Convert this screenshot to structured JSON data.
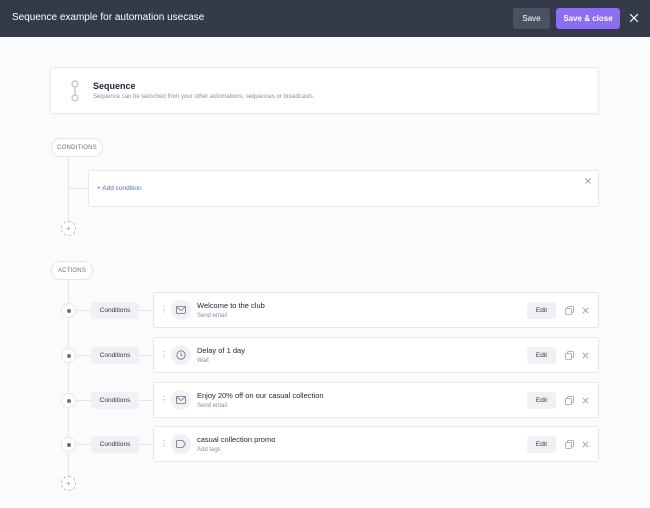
{
  "header": {
    "title": "Sequence example for automation usecase",
    "save_label": "Save",
    "save_close_label": "Save & close",
    "background": "#343a47",
    "accent": "#8b6ff0"
  },
  "sequence": {
    "title": "Sequence",
    "subtitle": "Sequence can be launched from your other automations, sequences or broadcasts.",
    "icon": "sequence-icon"
  },
  "conditions": {
    "label": "CONDITIONS",
    "add_label": "+ Add condition",
    "add_button": "+"
  },
  "actions": {
    "label": "ACTIONS",
    "add_button": "+",
    "items": [
      {
        "conditions_label": "Conditions",
        "title": "Welcome to the club",
        "subtitle": "Send email",
        "icon": "email-icon",
        "edit_label": "Edit"
      },
      {
        "conditions_label": "Conditions",
        "title": "Delay of 1 day",
        "subtitle": "Wait",
        "icon": "clock-icon",
        "edit_label": "Edit"
      },
      {
        "conditions_label": "Conditions",
        "title": "Enjoy 20% off on our casual collection",
        "subtitle": "Send email",
        "icon": "email-icon",
        "edit_label": "Edit"
      },
      {
        "conditions_label": "Conditions",
        "title": "casual collection promo",
        "subtitle": "Add tags",
        "icon": "tag-icon",
        "edit_label": "Edit"
      }
    ]
  }
}
